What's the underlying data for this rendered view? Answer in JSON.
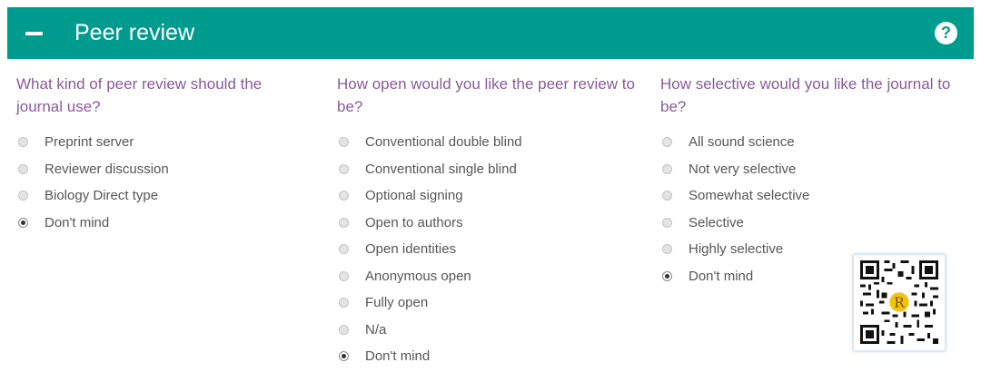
{
  "header": {
    "title": "Peer review",
    "help_symbol": "?",
    "background": "#009b8f",
    "collapse_icon": "minus-icon",
    "help_icon": "question-circle-icon"
  },
  "colors": {
    "question_text": "#8a5a9b",
    "option_text": "#565656"
  },
  "questions": [
    {
      "title": "What kind of peer review should the journal use?",
      "options": [
        {
          "label": "Preprint server",
          "selected": false
        },
        {
          "label": "Reviewer discussion",
          "selected": false
        },
        {
          "label": "Biology Direct type",
          "selected": false
        },
        {
          "label": "Don't mind",
          "selected": true
        }
      ]
    },
    {
      "title": "How open would you like the peer review to be?",
      "options": [
        {
          "label": "Conventional double blind",
          "selected": false
        },
        {
          "label": "Conventional single blind",
          "selected": false
        },
        {
          "label": "Optional signing",
          "selected": false
        },
        {
          "label": "Open to authors",
          "selected": false
        },
        {
          "label": "Open identities",
          "selected": false
        },
        {
          "label": "Anonymous open",
          "selected": false
        },
        {
          "label": "Fully open",
          "selected": false
        },
        {
          "label": "N/a",
          "selected": false
        },
        {
          "label": "Don't mind",
          "selected": true
        }
      ]
    },
    {
      "title": "How selective would you like the journal to be?",
      "options": [
        {
          "label": "All sound science",
          "selected": false
        },
        {
          "label": "Not very selective",
          "selected": false
        },
        {
          "label": "Somewhat selective",
          "selected": false
        },
        {
          "label": "Selective",
          "selected": false
        },
        {
          "label": "Highly selective",
          "selected": false
        },
        {
          "label": "Don't mind",
          "selected": true
        }
      ]
    }
  ],
  "qr_badge": {
    "icon": "qr-code-icon",
    "center_glyph": "R",
    "center_color": "#f1c40f"
  }
}
